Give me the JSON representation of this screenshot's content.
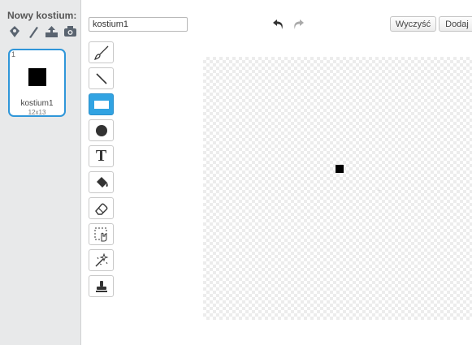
{
  "costume_panel": {
    "title": "Nowy kostium:",
    "new_costume_icons": [
      "paintbrush-library-icon",
      "paint-new-icon",
      "upload-icon",
      "camera-icon"
    ],
    "costumes": [
      {
        "index": "1",
        "name": "kostium1",
        "size": "12x13"
      }
    ]
  },
  "editor": {
    "costume_name_value": "kostium1",
    "clear_label": "Wyczyść",
    "add_label": "Dodaj",
    "tools": [
      "brush",
      "line",
      "rectangle",
      "ellipse",
      "text",
      "fill",
      "eraser",
      "select",
      "select-and-duplicate",
      "stamp"
    ],
    "active_tool": "rectangle",
    "text_tool_glyph": "T"
  },
  "colors": {
    "accent": "#31a3e2",
    "selected_border": "#2f96d9",
    "panel_bg": "#e8e9ea"
  }
}
